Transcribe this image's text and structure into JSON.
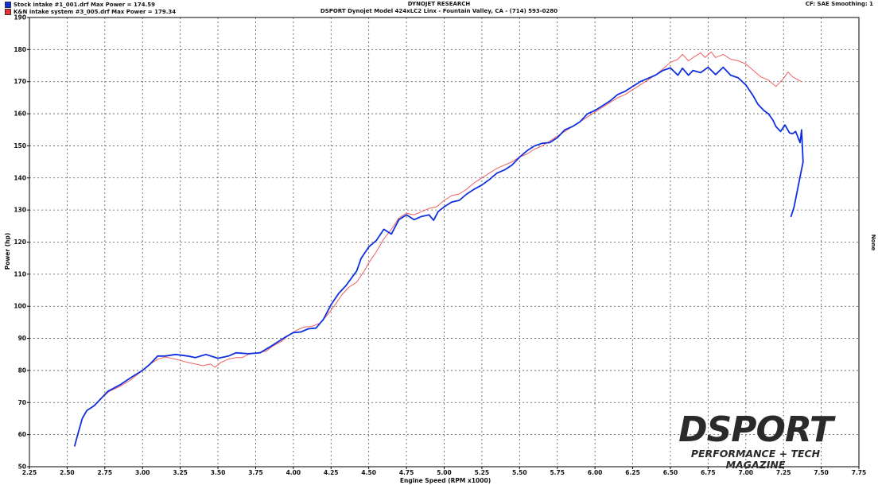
{
  "header": {
    "title": "DYNOJET RESEARCH",
    "subtitle": "DSPORT Dynojet Model 424xLC2 Linx - Fountain Valley, CA - (714) 593-0280",
    "right_info": "CF: SAE  Smoothing: 1",
    "right_axis_label": "None"
  },
  "watermark": {
    "main": "DSPORT",
    "sub": "PERFORMANCE + TECH MAGAZINE"
  },
  "colors": {
    "stock": "#1030e0",
    "kn": "#f06060",
    "grid": "#555555"
  },
  "chart_data": {
    "type": "line",
    "title": "DYNOJET RESEARCH",
    "xlabel": "Engine Speed (RPM x1000)",
    "ylabel": "Power (hp)",
    "xlim": [
      2.25,
      7.75
    ],
    "ylim": [
      50,
      190
    ],
    "x_ticks": [
      "2.25",
      "2.50",
      "2.75",
      "3.00",
      "3.25",
      "3.50",
      "3.75",
      "4.00",
      "4.25",
      "4.50",
      "4.75",
      "5.00",
      "5.25",
      "5.50",
      "5.75",
      "6.00",
      "6.25",
      "6.50",
      "6.75",
      "7.00",
      "7.25",
      "7.50",
      "7.75"
    ],
    "y_ticks": [
      "50",
      "60",
      "70",
      "80",
      "90",
      "100",
      "110",
      "120",
      "130",
      "140",
      "150",
      "160",
      "170",
      "180",
      "190"
    ],
    "grid": true,
    "legend_position": "top-left",
    "series": [
      {
        "name": "Stock intake #1_001.drf Max Power = 174.59",
        "color": "#1030e0",
        "points": [
          [
            2.55,
            56.5
          ],
          [
            2.57,
            60
          ],
          [
            2.6,
            65
          ],
          [
            2.63,
            67.5
          ],
          [
            2.68,
            69
          ],
          [
            2.72,
            71
          ],
          [
            2.77,
            73.5
          ],
          [
            2.85,
            75.5
          ],
          [
            2.93,
            78
          ],
          [
            3.0,
            80
          ],
          [
            3.05,
            82
          ],
          [
            3.1,
            84.5
          ],
          [
            3.15,
            84.5
          ],
          [
            3.22,
            85
          ],
          [
            3.3,
            84.5
          ],
          [
            3.35,
            84
          ],
          [
            3.42,
            85
          ],
          [
            3.5,
            83.8
          ],
          [
            3.57,
            84.5
          ],
          [
            3.62,
            85.5
          ],
          [
            3.7,
            85.2
          ],
          [
            3.78,
            85.5
          ],
          [
            3.85,
            87.5
          ],
          [
            3.9,
            89
          ],
          [
            3.95,
            90.5
          ],
          [
            4.0,
            91.8
          ],
          [
            4.05,
            92
          ],
          [
            4.1,
            93
          ],
          [
            4.15,
            93.2
          ],
          [
            4.2,
            96
          ],
          [
            4.25,
            100.5
          ],
          [
            4.3,
            104
          ],
          [
            4.35,
            106.5
          ],
          [
            4.42,
            111
          ],
          [
            4.45,
            115
          ],
          [
            4.5,
            118.5
          ],
          [
            4.55,
            120.5
          ],
          [
            4.6,
            124
          ],
          [
            4.65,
            122.5
          ],
          [
            4.7,
            127
          ],
          [
            4.75,
            128.5
          ],
          [
            4.8,
            127
          ],
          [
            4.85,
            128
          ],
          [
            4.9,
            128.5
          ],
          [
            4.93,
            126.8
          ],
          [
            4.96,
            129.5
          ],
          [
            5.0,
            131
          ],
          [
            5.05,
            132.5
          ],
          [
            5.1,
            133
          ],
          [
            5.15,
            135
          ],
          [
            5.2,
            136.5
          ],
          [
            5.25,
            137.8
          ],
          [
            5.3,
            139.5
          ],
          [
            5.35,
            141.5
          ],
          [
            5.4,
            142.5
          ],
          [
            5.45,
            144
          ],
          [
            5.5,
            146.5
          ],
          [
            5.55,
            148.5
          ],
          [
            5.6,
            150
          ],
          [
            5.65,
            150.8
          ],
          [
            5.7,
            151
          ],
          [
            5.75,
            152.5
          ],
          [
            5.8,
            155
          ],
          [
            5.85,
            156
          ],
          [
            5.9,
            157.5
          ],
          [
            5.95,
            160
          ],
          [
            6.0,
            161
          ],
          [
            6.05,
            162.5
          ],
          [
            6.1,
            164
          ],
          [
            6.15,
            166
          ],
          [
            6.2,
            167
          ],
          [
            6.25,
            168.5
          ],
          [
            6.3,
            170
          ],
          [
            6.35,
            171
          ],
          [
            6.4,
            172
          ],
          [
            6.45,
            173.5
          ],
          [
            6.5,
            174.3
          ],
          [
            6.55,
            172
          ],
          [
            6.58,
            174.2
          ],
          [
            6.62,
            172
          ],
          [
            6.65,
            173.5
          ],
          [
            6.7,
            172.8
          ],
          [
            6.75,
            174.5
          ],
          [
            6.8,
            172.2
          ],
          [
            6.85,
            174.5
          ],
          [
            6.9,
            172
          ],
          [
            6.95,
            171.2
          ],
          [
            7.0,
            169
          ],
          [
            7.05,
            165.5
          ],
          [
            7.08,
            163
          ],
          [
            7.12,
            161
          ],
          [
            7.15,
            160
          ],
          [
            7.18,
            158
          ],
          [
            7.2,
            156
          ],
          [
            7.23,
            154.5
          ],
          [
            7.26,
            156.5
          ],
          [
            7.29,
            154
          ],
          [
            7.31,
            153.8
          ],
          [
            7.33,
            154.5
          ],
          [
            7.36,
            151
          ],
          [
            7.37,
            155
          ],
          [
            7.38,
            145
          ],
          [
            7.35,
            138
          ],
          [
            7.32,
            131
          ],
          [
            7.3,
            128
          ]
        ]
      },
      {
        "name": "K&N intake system #3_005.drf Max Power = 179.34",
        "color": "#f06060",
        "points": [
          [
            2.73,
            71.5
          ],
          [
            2.78,
            73.5
          ],
          [
            2.85,
            75
          ],
          [
            2.92,
            77
          ],
          [
            3.0,
            80
          ],
          [
            3.05,
            82
          ],
          [
            3.1,
            83.5
          ],
          [
            3.15,
            84.2
          ],
          [
            3.22,
            83.5
          ],
          [
            3.3,
            82.5
          ],
          [
            3.35,
            82
          ],
          [
            3.4,
            81.5
          ],
          [
            3.45,
            82
          ],
          [
            3.48,
            81
          ],
          [
            3.52,
            82.5
          ],
          [
            3.57,
            83.5
          ],
          [
            3.62,
            84
          ],
          [
            3.66,
            84
          ],
          [
            3.7,
            85
          ],
          [
            3.76,
            85.5
          ],
          [
            3.82,
            86
          ],
          [
            3.86,
            87.5
          ],
          [
            3.92,
            89
          ],
          [
            3.97,
            91
          ],
          [
            4.02,
            92.5
          ],
          [
            4.07,
            93.5
          ],
          [
            4.12,
            93.7
          ],
          [
            4.18,
            94.8
          ],
          [
            4.22,
            97
          ],
          [
            4.27,
            100
          ],
          [
            4.32,
            103.5
          ],
          [
            4.37,
            106
          ],
          [
            4.42,
            107.5
          ],
          [
            4.47,
            111
          ],
          [
            4.5,
            113.5
          ],
          [
            4.55,
            117
          ],
          [
            4.6,
            121
          ],
          [
            4.65,
            124
          ],
          [
            4.7,
            127.5
          ],
          [
            4.75,
            129
          ],
          [
            4.8,
            128.5
          ],
          [
            4.85,
            129.5
          ],
          [
            4.9,
            130.5
          ],
          [
            4.95,
            131
          ],
          [
            5.0,
            133
          ],
          [
            5.05,
            134.5
          ],
          [
            5.1,
            135
          ],
          [
            5.15,
            136.5
          ],
          [
            5.2,
            138.5
          ],
          [
            5.25,
            140
          ],
          [
            5.3,
            141.5
          ],
          [
            5.35,
            143
          ],
          [
            5.4,
            144
          ],
          [
            5.45,
            145
          ],
          [
            5.5,
            146.5
          ],
          [
            5.55,
            147.5
          ],
          [
            5.6,
            149
          ],
          [
            5.65,
            150
          ],
          [
            5.7,
            151.5
          ],
          [
            5.75,
            153
          ],
          [
            5.8,
            154.5
          ],
          [
            5.85,
            156
          ],
          [
            5.9,
            157.5
          ],
          [
            5.95,
            159
          ],
          [
            6.0,
            160.5
          ],
          [
            6.05,
            162
          ],
          [
            6.1,
            163.5
          ],
          [
            6.15,
            165
          ],
          [
            6.2,
            166
          ],
          [
            6.25,
            167.5
          ],
          [
            6.3,
            169
          ],
          [
            6.35,
            170.5
          ],
          [
            6.4,
            172
          ],
          [
            6.45,
            174
          ],
          [
            6.5,
            176
          ],
          [
            6.55,
            177
          ],
          [
            6.58,
            178.5
          ],
          [
            6.62,
            176.5
          ],
          [
            6.65,
            177.5
          ],
          [
            6.7,
            179
          ],
          [
            6.73,
            177.5
          ],
          [
            6.77,
            179.3
          ],
          [
            6.8,
            177.5
          ],
          [
            6.85,
            178.5
          ],
          [
            6.9,
            177
          ],
          [
            6.95,
            176.5
          ],
          [
            7.0,
            175.5
          ],
          [
            7.05,
            173.5
          ],
          [
            7.1,
            171.5
          ],
          [
            7.15,
            170.5
          ],
          [
            7.2,
            168.5
          ],
          [
            7.25,
            171
          ],
          [
            7.28,
            173
          ],
          [
            7.31,
            171.5
          ],
          [
            7.35,
            170.5
          ],
          [
            7.37,
            170
          ]
        ]
      }
    ]
  }
}
